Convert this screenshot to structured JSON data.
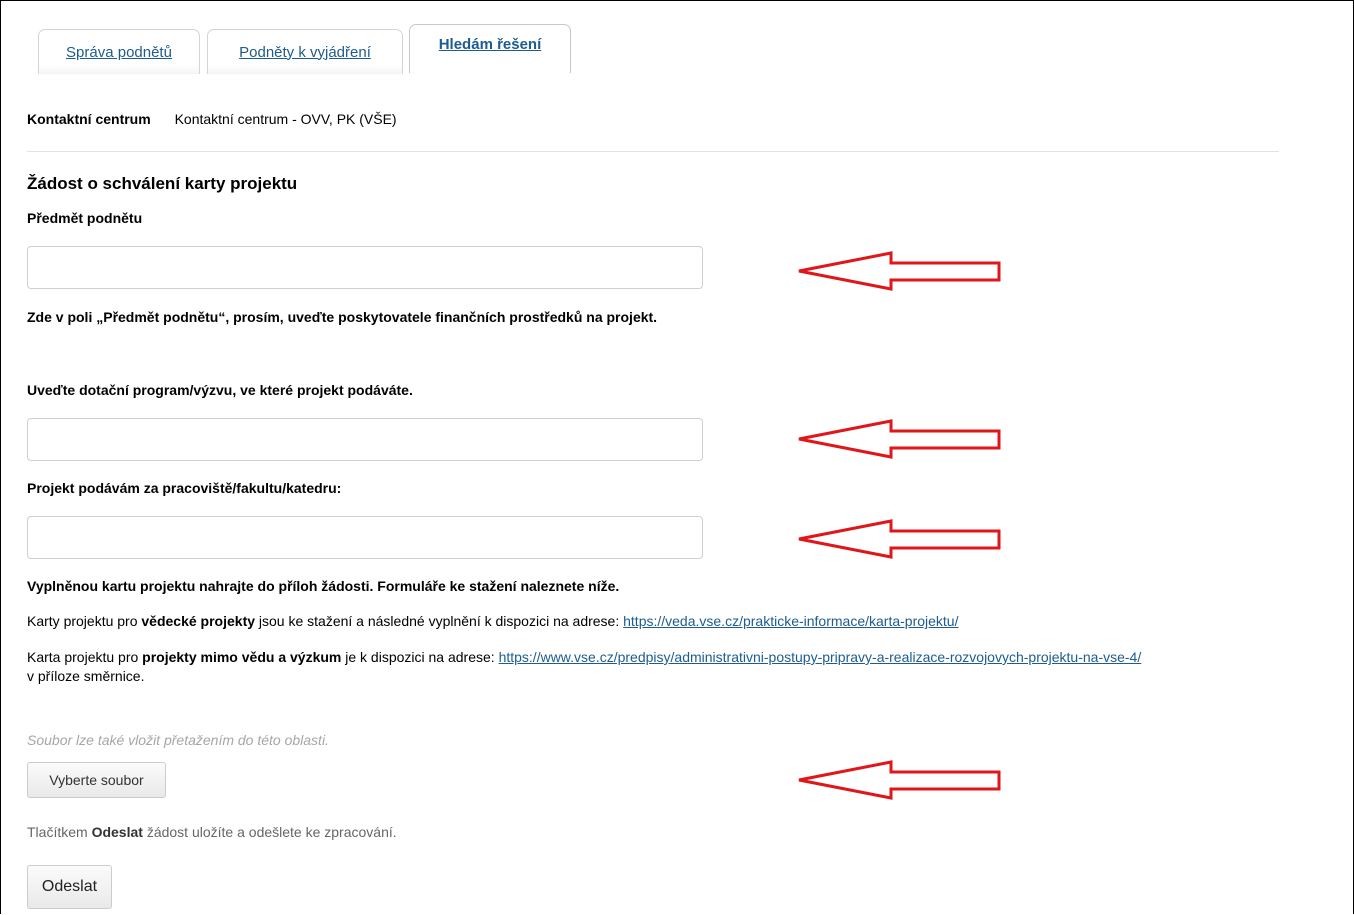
{
  "tabs": [
    {
      "label": "Správa podnětů",
      "active": false
    },
    {
      "label": "Podněty k vyjádření",
      "active": false
    },
    {
      "label": "Hledám řešení",
      "active": true
    }
  ],
  "contact_center": {
    "label": "Kontaktní centrum",
    "value": "Kontaktní centrum - OVV, PK (VŠE)"
  },
  "form": {
    "title": "Žádost o schválení karty projektu",
    "subject_label": "Předmět podnětu",
    "subject_value": "",
    "subject_hint": "Zde v poli „Předmět podnětu“, prosím, uveďte poskytovatele finančních prostředků na projekt.",
    "program_label": "Uveďte dotační program/výzvu, ve které projekt podáváte.",
    "program_value": "",
    "workplace_label": "Projekt podávám za pracoviště/fakultu/katedru:",
    "workplace_value": "",
    "upload_instruction": "Vyplněnou kartu projektu nahrajte do příloh žádosti. Formuláře ke stažení naleznete níže.",
    "science_line": {
      "prefix": "Karty projektu pro ",
      "bold": "vědecké projekty",
      "middle": " jsou ke stažení a následné vyplnění k dispozici na adrese: ",
      "link": "https://veda.vse.cz/prakticke-informace/karta-projektu/"
    },
    "nonscience_line": {
      "prefix": "Karta projektu pro ",
      "bold": "projekty mimo vědu a výzkum",
      "middle": " je k dispozici na adrese: ",
      "link": "https://www.vse.cz/predpisy/administrativni-postupy-pripravy-a-realizace-rozvojovych-projektu-na-vse-4/",
      "suffix": "v příloze směrnice."
    },
    "drop_hint": "Soubor lze také vložit přetažením do této oblasti.",
    "choose_file_label": "Vyberte soubor",
    "submit_note": {
      "prefix": "Tlačítkem ",
      "bold": "Odeslat",
      "suffix": " žádost uložíte a odešlete ke zpracování."
    },
    "submit_label": "Odeslat"
  },
  "annotation_color": "#e0161b"
}
